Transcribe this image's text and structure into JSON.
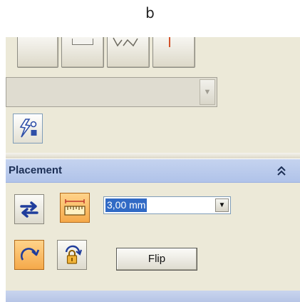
{
  "caption": "b",
  "placement": {
    "title": "Placement",
    "collapse_glyph": "«",
    "offset_value": "3,00 mm",
    "flip_label": "Flip"
  },
  "icons": {
    "action": "lightning-shape-icon",
    "swap": "swap-arrows-icon",
    "measure": "ruler-icon",
    "rotate": "rotate-arrow-icon",
    "lock_rotate": "lock-rotate-icon"
  },
  "colors": {
    "panel_bg": "#ece9d8",
    "header_bg": "#b0c3e9",
    "active_btn": "#f5a94a",
    "selection": "#316ac5"
  }
}
